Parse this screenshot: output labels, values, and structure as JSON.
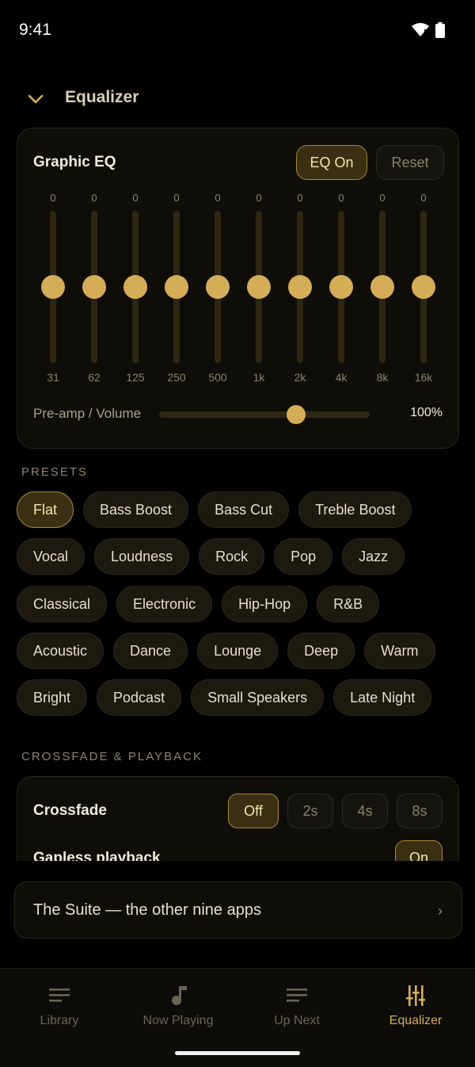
{
  "status": {
    "time": "9:41"
  },
  "header": {
    "title": "Equalizer"
  },
  "eq": {
    "title": "Graphic EQ",
    "on_label": "EQ On",
    "reset_label": "Reset",
    "bands": [
      {
        "freq": "31",
        "gain": "0"
      },
      {
        "freq": "62",
        "gain": "0"
      },
      {
        "freq": "125",
        "gain": "0"
      },
      {
        "freq": "250",
        "gain": "0"
      },
      {
        "freq": "500",
        "gain": "0"
      },
      {
        "freq": "1k",
        "gain": "0"
      },
      {
        "freq": "2k",
        "gain": "0"
      },
      {
        "freq": "4k",
        "gain": "0"
      },
      {
        "freq": "8k",
        "gain": "0"
      },
      {
        "freq": "16k",
        "gain": "0"
      }
    ],
    "preamp_label": "Pre-amp / Volume",
    "preamp_value": "100%",
    "preamp_level": 0.65
  },
  "presets": {
    "heading": "PRESETS",
    "rows": [
      [
        "Flat",
        "Bass Boost",
        "Bass Cut",
        "Treble Boost"
      ],
      [
        "Vocal",
        "Loudness",
        "Rock",
        "Pop",
        "Jazz"
      ],
      [
        "Classical",
        "Electronic",
        "Hip-Hop",
        "R&B"
      ],
      [
        "Acoustic",
        "Dance",
        "Lounge",
        "Deep",
        "Warm"
      ],
      [
        "Bright",
        "Podcast",
        "Small Speakers",
        "Late Night"
      ]
    ],
    "selected": "Flat"
  },
  "crossfade": {
    "heading": "CROSSFADE & PLAYBACK",
    "title": "Crossfade",
    "options": [
      "Off",
      "2s",
      "4s",
      "8s"
    ],
    "selected": "Off",
    "gapless_title": "Gapless playback",
    "gapless_value": "On"
  },
  "suite": {
    "text": "The Suite — the other nine apps",
    "chevron": "›"
  },
  "nav": {
    "items": [
      {
        "label": "Library",
        "icon": "library-icon"
      },
      {
        "label": "Now Playing",
        "icon": "music-note-icon"
      },
      {
        "label": "Up Next",
        "icon": "queue-icon"
      },
      {
        "label": "Equalizer",
        "icon": "equalizer-icon"
      }
    ],
    "active": "Equalizer"
  },
  "colors": {
    "accent": "#d5ad57",
    "background": "#000000",
    "card": "#0f0d08"
  }
}
